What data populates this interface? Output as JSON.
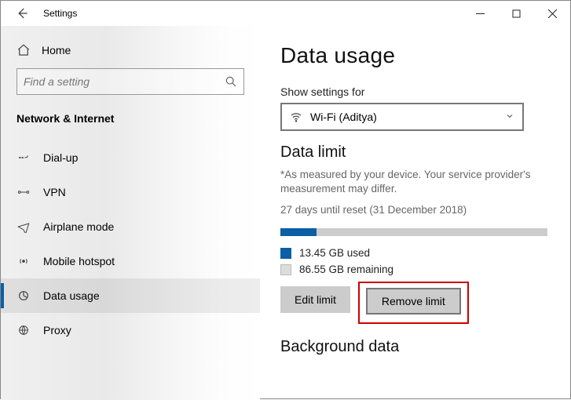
{
  "window": {
    "title": "Settings"
  },
  "sidebar": {
    "home": "Home",
    "search_placeholder": "Find a setting",
    "section": "Network & Internet",
    "items": [
      {
        "label": "Dial-up"
      },
      {
        "label": "VPN"
      },
      {
        "label": "Airplane mode"
      },
      {
        "label": "Mobile hotspot"
      },
      {
        "label": "Data usage"
      },
      {
        "label": "Proxy"
      }
    ]
  },
  "main": {
    "title": "Data usage",
    "show_settings_for": "Show settings for",
    "dropdown_value": "Wi-Fi (Aditya)",
    "data_limit_head": "Data limit",
    "measure_hint": "*As measured by your device. Your service provider's measurement may differ.",
    "reset_line": "27 days until reset (31 December 2018)",
    "used_label": "13.45 GB used",
    "remaining_label": "86.55 GB remaining",
    "used_percent": 13.45,
    "edit_btn": "Edit limit",
    "remove_btn": "Remove limit",
    "background_head": "Background data"
  }
}
